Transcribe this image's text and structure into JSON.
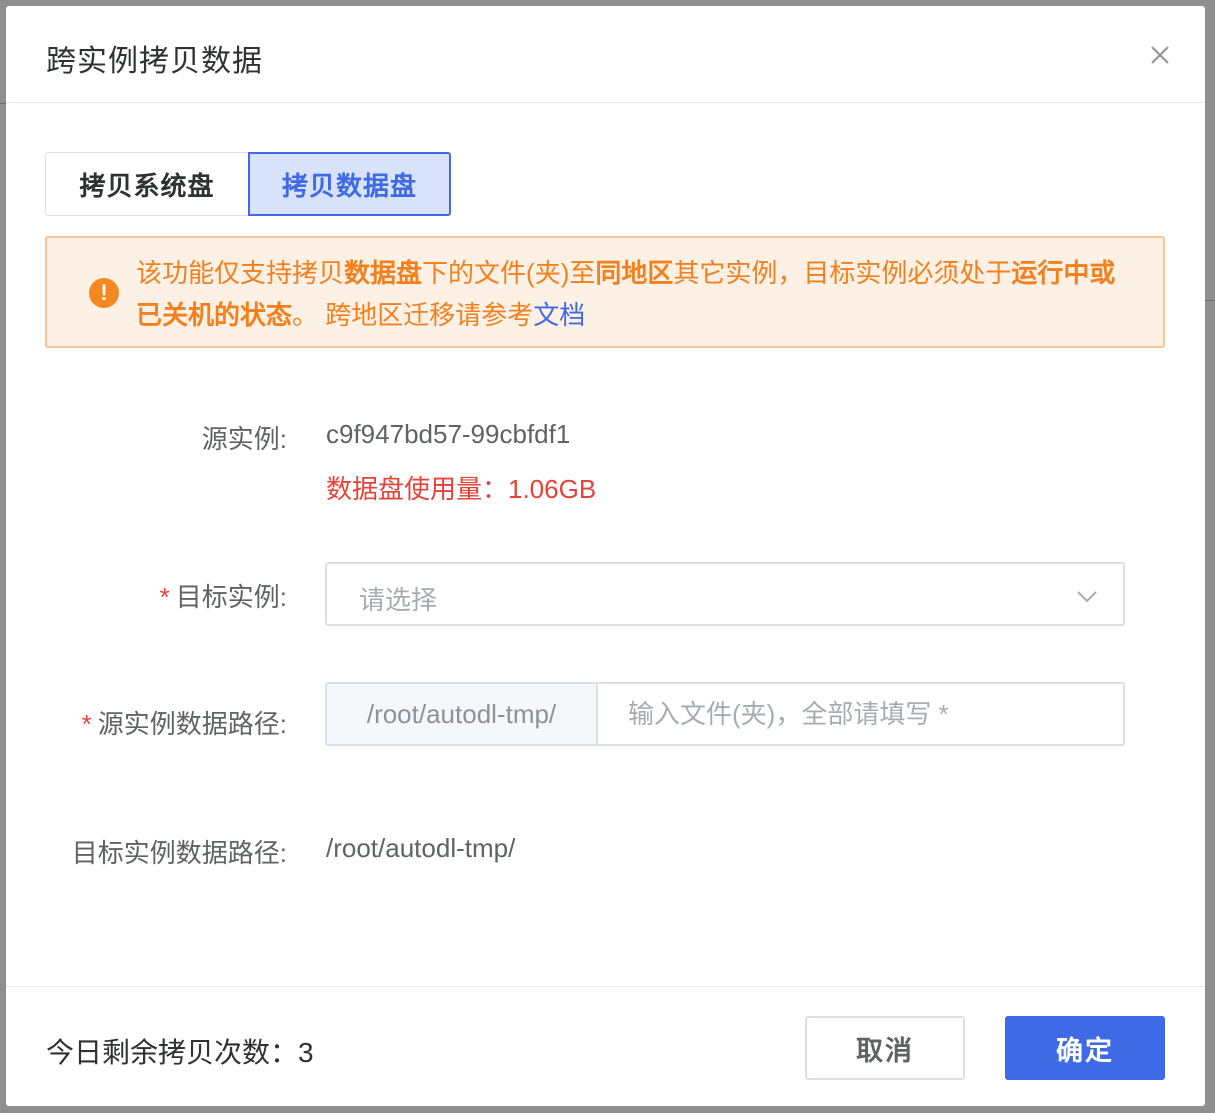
{
  "modal": {
    "title": "跨实例拷贝数据"
  },
  "tabs": [
    {
      "label": "拷贝系统盘",
      "active": false
    },
    {
      "label": "拷贝数据盘",
      "active": true
    }
  ],
  "alert": {
    "icon": "exclamation-icon",
    "segments": {
      "t1": "该功能仅支持拷贝",
      "b1": "数据盘",
      "t2": "下的文件(夹)至",
      "b2": "同地区",
      "t3": "其它实例，目标实例必须处于",
      "b3": "运行中或已关机的状态",
      "t4": "。 跨地区迁移请参考",
      "link": "文档"
    },
    "colors": {
      "text": "#f3801c",
      "link": "#3f6ae6",
      "background": "#fdf1e6"
    }
  },
  "form": {
    "source_instance": {
      "label": "源实例:",
      "value": "c9f947bd57-99cbfdf1",
      "usage": "数据盘使用量：1.06GB"
    },
    "target_instance": {
      "required_mark": "*",
      "label": "目标实例:",
      "placeholder": "请选择"
    },
    "source_path": {
      "required_mark": "*",
      "label": "源实例数据路径:",
      "prefix": "/root/autodl-tmp/",
      "placeholder": "输入文件(夹)，全部请填写 *"
    },
    "target_path": {
      "label": "目标实例数据路径:",
      "value": "/root/autodl-tmp/"
    }
  },
  "footer": {
    "remaining": "今日剩余拷贝次数：3",
    "cancel_label": "取消",
    "confirm_label": "确定"
  },
  "colors": {
    "primary": "#3f6ae6",
    "danger": "#e5433a",
    "warning": "#f3801c"
  }
}
